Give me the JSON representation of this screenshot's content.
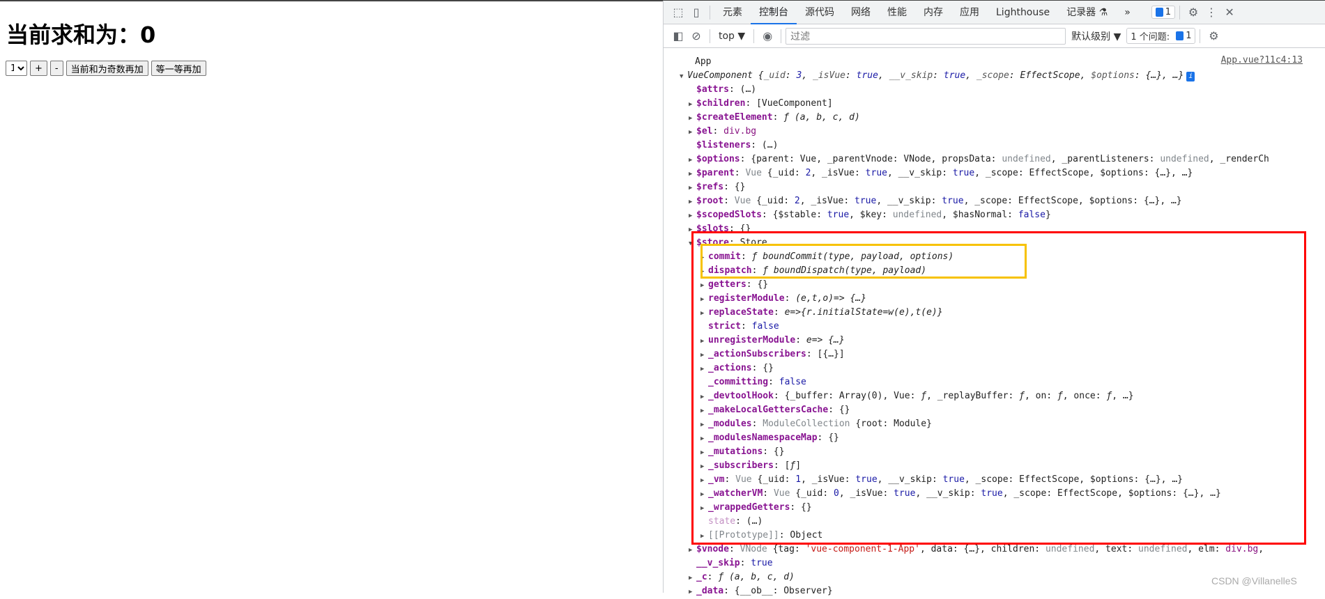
{
  "page": {
    "heading": "当前求和为：0",
    "select_value": "1",
    "buttons": [
      "+",
      "-",
      "当前和为奇数再加",
      "等一等再加"
    ]
  },
  "devtools": {
    "tabs": [
      "元素",
      "控制台",
      "源代码",
      "网络",
      "性能",
      "内存",
      "应用",
      "Lighthouse",
      "记录器 ⚗"
    ],
    "active_tab": "控制台",
    "more_tabs": "»",
    "issues_badge": "1",
    "context": "top ▼",
    "filter_placeholder": "过滤",
    "level": "默认级别 ▼",
    "issues_label": "1 个问题:",
    "issues_count": "1"
  },
  "console": {
    "source_link": "App.vue?11c4:13",
    "rows": [
      {
        "lvl": 0,
        "arrow": "",
        "segs": [
          [
            "App",
            ""
          ]
        ]
      },
      {
        "lvl": 0,
        "arrow": "▼",
        "info": true,
        "segs": [
          [
            "VueComponent {",
            "f"
          ],
          [
            "_uid",
            "f pk"
          ],
          [
            ": ",
            "f"
          ],
          [
            "3",
            "f b"
          ],
          [
            ", ",
            "f"
          ],
          [
            "_isVue",
            "f pk"
          ],
          [
            ": ",
            "f"
          ],
          [
            "true",
            "f b"
          ],
          [
            ", ",
            "f"
          ],
          [
            "__v_skip",
            "f pk"
          ],
          [
            ": ",
            "f"
          ],
          [
            "true",
            "f b"
          ],
          [
            ", ",
            "f"
          ],
          [
            "_scope",
            "f pk"
          ],
          [
            ": EffectScope, ",
            "f"
          ],
          [
            "$options",
            "f pk"
          ],
          [
            ": {…}, …}",
            "f"
          ]
        ]
      },
      {
        "lvl": 1,
        "arrow": "",
        "segs": [
          [
            "$attrs",
            "k"
          ],
          [
            ": (…)",
            ""
          ]
        ]
      },
      {
        "lvl": 1,
        "arrow": "▶",
        "segs": [
          [
            "$children",
            "k"
          ],
          [
            ": [VueComponent]",
            ""
          ]
        ]
      },
      {
        "lvl": 1,
        "arrow": "▶",
        "segs": [
          [
            "$createElement",
            "k"
          ],
          [
            ": ",
            ""
          ],
          [
            "ƒ (a, b, c, d)",
            "f"
          ]
        ]
      },
      {
        "lvl": 1,
        "arrow": "▶",
        "segs": [
          [
            "$el",
            "k"
          ],
          [
            ": ",
            ""
          ],
          [
            "div.bg",
            "t"
          ]
        ]
      },
      {
        "lvl": 1,
        "arrow": "",
        "segs": [
          [
            "$listeners",
            "k"
          ],
          [
            ": (…)",
            ""
          ]
        ]
      },
      {
        "lvl": 1,
        "arrow": "▶",
        "segs": [
          [
            "$options",
            "k"
          ],
          [
            ": {parent: Vue, _parentVnode: VNode, propsData: ",
            ""
          ],
          [
            "undefined",
            "g"
          ],
          [
            ", _parentListeners: ",
            ""
          ],
          [
            "undefined",
            "g"
          ],
          [
            ", _renderCh",
            ""
          ]
        ]
      },
      {
        "lvl": 1,
        "arrow": "▶",
        "segs": [
          [
            "$parent",
            "k"
          ],
          [
            ": ",
            ""
          ],
          [
            "Vue",
            "g"
          ],
          [
            " {_uid: ",
            ""
          ],
          [
            "2",
            "b"
          ],
          [
            ", _isVue: ",
            ""
          ],
          [
            "true",
            "b"
          ],
          [
            ", __v_skip: ",
            ""
          ],
          [
            "true",
            "b"
          ],
          [
            ", _scope: EffectScope, $options: {…}, …}",
            ""
          ]
        ]
      },
      {
        "lvl": 1,
        "arrow": "▶",
        "segs": [
          [
            "$refs",
            "k"
          ],
          [
            ": {}",
            ""
          ]
        ]
      },
      {
        "lvl": 1,
        "arrow": "▶",
        "segs": [
          [
            "$root",
            "k"
          ],
          [
            ": ",
            ""
          ],
          [
            "Vue",
            "g"
          ],
          [
            " {_uid: ",
            ""
          ],
          [
            "2",
            "b"
          ],
          [
            ", _isVue: ",
            ""
          ],
          [
            "true",
            "b"
          ],
          [
            ", __v_skip: ",
            ""
          ],
          [
            "true",
            "b"
          ],
          [
            ", _scope: EffectScope, $options: {…}, …}",
            ""
          ]
        ]
      },
      {
        "lvl": 1,
        "arrow": "▶",
        "segs": [
          [
            "$scopedSlots",
            "k"
          ],
          [
            ": {$stable: ",
            ""
          ],
          [
            "true",
            "b"
          ],
          [
            ", $key: ",
            ""
          ],
          [
            "undefined",
            "g"
          ],
          [
            ", $hasNormal: ",
            ""
          ],
          [
            "false",
            "b"
          ],
          [
            "}",
            ""
          ]
        ]
      },
      {
        "lvl": 1,
        "arrow": "▶",
        "segs": [
          [
            "$slots",
            "k"
          ],
          [
            ": {}",
            ""
          ]
        ]
      },
      {
        "lvl": 1,
        "arrow": "▼",
        "segs": [
          [
            "$store",
            "k"
          ],
          [
            ": Store",
            ""
          ]
        ]
      },
      {
        "lvl": 2,
        "arrow": "▶",
        "segs": [
          [
            "commit",
            "k"
          ],
          [
            ": ",
            ""
          ],
          [
            "ƒ boundCommit(type, payload, options)",
            "f"
          ]
        ]
      },
      {
        "lvl": 2,
        "arrow": "▶",
        "segs": [
          [
            "dispatch",
            "k"
          ],
          [
            ": ",
            ""
          ],
          [
            "ƒ boundDispatch(type, payload)",
            "f"
          ]
        ]
      },
      {
        "lvl": 2,
        "arrow": "▶",
        "segs": [
          [
            "getters",
            "k"
          ],
          [
            ": {}",
            ""
          ]
        ]
      },
      {
        "lvl": 2,
        "arrow": "▶",
        "segs": [
          [
            "registerModule",
            "k"
          ],
          [
            ": ",
            ""
          ],
          [
            "(e,t,o)=> {…}",
            "f"
          ]
        ]
      },
      {
        "lvl": 2,
        "arrow": "▶",
        "segs": [
          [
            "replaceState",
            "k"
          ],
          [
            ": ",
            ""
          ],
          [
            "e=>{r.initialState=w(e),t(e)}",
            "f"
          ]
        ]
      },
      {
        "lvl": 2,
        "arrow": "",
        "segs": [
          [
            "strict",
            "k"
          ],
          [
            ": ",
            ""
          ],
          [
            "false",
            "b"
          ]
        ]
      },
      {
        "lvl": 2,
        "arrow": "▶",
        "segs": [
          [
            "unregisterModule",
            "k"
          ],
          [
            ": ",
            ""
          ],
          [
            "e=> {…}",
            "f"
          ]
        ]
      },
      {
        "lvl": 2,
        "arrow": "▶",
        "segs": [
          [
            "_actionSubscribers",
            "k"
          ],
          [
            ": [{…}]",
            ""
          ]
        ]
      },
      {
        "lvl": 2,
        "arrow": "▶",
        "segs": [
          [
            "_actions",
            "k"
          ],
          [
            ": {}",
            ""
          ]
        ]
      },
      {
        "lvl": 2,
        "arrow": "",
        "segs": [
          [
            "_committing",
            "k"
          ],
          [
            ": ",
            ""
          ],
          [
            "false",
            "b"
          ]
        ]
      },
      {
        "lvl": 2,
        "arrow": "▶",
        "segs": [
          [
            "_devtoolHook",
            "k"
          ],
          [
            ": {_buffer: Array(0), Vue: ",
            ""
          ],
          [
            "ƒ",
            "f"
          ],
          [
            ", _replayBuffer: ",
            ""
          ],
          [
            "ƒ",
            "f"
          ],
          [
            ", on: ",
            ""
          ],
          [
            "ƒ",
            "f"
          ],
          [
            ", once: ",
            ""
          ],
          [
            "ƒ",
            "f"
          ],
          [
            ", …}",
            ""
          ]
        ]
      },
      {
        "lvl": 2,
        "arrow": "▶",
        "segs": [
          [
            "_makeLocalGettersCache",
            "k"
          ],
          [
            ": {}",
            ""
          ]
        ]
      },
      {
        "lvl": 2,
        "arrow": "▶",
        "segs": [
          [
            "_modules",
            "k"
          ],
          [
            ": ",
            ""
          ],
          [
            "ModuleCollection",
            "g"
          ],
          [
            " {root: Module}",
            ""
          ]
        ]
      },
      {
        "lvl": 2,
        "arrow": "▶",
        "segs": [
          [
            "_modulesNamespaceMap",
            "k"
          ],
          [
            ": {}",
            ""
          ]
        ]
      },
      {
        "lvl": 2,
        "arrow": "▶",
        "segs": [
          [
            "_mutations",
            "k"
          ],
          [
            ": {}",
            ""
          ]
        ]
      },
      {
        "lvl": 2,
        "arrow": "▶",
        "segs": [
          [
            "_subscribers",
            "k"
          ],
          [
            ": [",
            ""
          ],
          [
            "ƒ",
            "f"
          ],
          [
            "]",
            ""
          ]
        ]
      },
      {
        "lvl": 2,
        "arrow": "▶",
        "segs": [
          [
            "_vm",
            "k"
          ],
          [
            ": ",
            ""
          ],
          [
            "Vue",
            "g"
          ],
          [
            " {_uid: ",
            ""
          ],
          [
            "1",
            "b"
          ],
          [
            ", _isVue: ",
            ""
          ],
          [
            "true",
            "b"
          ],
          [
            ", __v_skip: ",
            ""
          ],
          [
            "true",
            "b"
          ],
          [
            ", _scope: EffectScope, $options: {…}, …}",
            ""
          ]
        ]
      },
      {
        "lvl": 2,
        "arrow": "▶",
        "segs": [
          [
            "_watcherVM",
            "k"
          ],
          [
            ": ",
            ""
          ],
          [
            "Vue",
            "g"
          ],
          [
            " {_uid: ",
            ""
          ],
          [
            "0",
            "b"
          ],
          [
            ", _isVue: ",
            ""
          ],
          [
            "true",
            "b"
          ],
          [
            ", __v_skip: ",
            ""
          ],
          [
            "true",
            "b"
          ],
          [
            ", _scope: EffectScope, $options: {…}, …}",
            ""
          ]
        ]
      },
      {
        "lvl": 2,
        "arrow": "▶",
        "segs": [
          [
            "_wrappedGetters",
            "k"
          ],
          [
            ": {}",
            ""
          ]
        ]
      },
      {
        "lvl": 2,
        "arrow": "",
        "segs": [
          [
            "state",
            "d"
          ],
          [
            ": (…)",
            ""
          ]
        ]
      },
      {
        "lvl": 2,
        "arrow": "▶",
        "segs": [
          [
            "[[Prototype]]",
            "g"
          ],
          [
            ": Object",
            ""
          ]
        ]
      },
      {
        "lvl": 1,
        "arrow": "▶",
        "segs": [
          [
            "$vnode",
            "k"
          ],
          [
            ": ",
            ""
          ],
          [
            "VNode",
            "g"
          ],
          [
            " {tag: ",
            ""
          ],
          [
            "'vue-component-1-App'",
            "s"
          ],
          [
            ", data: {…}, children: ",
            ""
          ],
          [
            "undefined",
            "g"
          ],
          [
            ", text: ",
            ""
          ],
          [
            "undefined",
            "g"
          ],
          [
            ", elm: ",
            ""
          ],
          [
            "div.bg",
            "t"
          ],
          [
            ",",
            ""
          ]
        ]
      },
      {
        "lvl": 1,
        "arrow": "",
        "segs": [
          [
            "__v_skip",
            "k"
          ],
          [
            ": ",
            ""
          ],
          [
            "true",
            "b"
          ]
        ]
      },
      {
        "lvl": 1,
        "arrow": "▶",
        "segs": [
          [
            "_c",
            "k"
          ],
          [
            ": ",
            ""
          ],
          [
            "ƒ (a, b, c, d)",
            "f"
          ]
        ]
      },
      {
        "lvl": 1,
        "arrow": "▶",
        "segs": [
          [
            "_data",
            "k"
          ],
          [
            ": {__ob__: Observer}",
            ""
          ]
        ]
      }
    ]
  },
  "watermark": "CSDN @VillanelleS",
  "colors": {
    "highlight_outer": "#ff0000",
    "highlight_inner": "#f7c200",
    "accent": "#1a73e8"
  }
}
